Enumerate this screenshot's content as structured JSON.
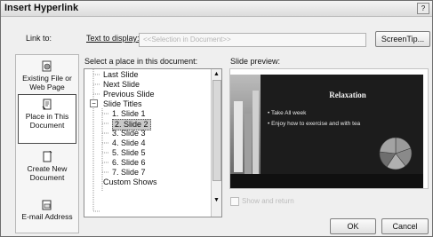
{
  "dialog": {
    "title": "Insert Hyperlink",
    "help_button": "?",
    "link_to_label": "Link to:",
    "text_display_label": "Text to display:",
    "text_display_value": "<<Selection in Document>>",
    "screentip_button": "ScreenTip...",
    "select_place_label": "Select a place in this document:",
    "slide_preview_label": "Slide preview:",
    "show_and_return_label": "Show and return",
    "ok_button": "OK",
    "cancel_button": "Cancel"
  },
  "link_to": [
    {
      "line1": "Existing File or",
      "line2": "Web Page",
      "icon": "globe-file-icon"
    },
    {
      "line1": "Place in This",
      "line2": "Document",
      "icon": "document-place-icon"
    },
    {
      "line1": "Create New",
      "line2": "Document",
      "icon": "new-document-icon"
    },
    {
      "line1": "E-mail Address",
      "line2": "",
      "icon": "email-icon"
    }
  ],
  "tree": {
    "items": [
      "Last Slide",
      "Next Slide",
      "Previous Slide",
      "Slide Titles",
      "1. Slide 1",
      "2. Slide 2",
      "3. Slide 3",
      "4. Slide 4",
      "5. Slide 5",
      "6. Slide 6",
      "7. Slide 7",
      "Custom Shows"
    ],
    "selected": "2. Slide 2"
  },
  "slide": {
    "title": "Relaxation",
    "bullet1": "Take All week",
    "bullet2": "Enjoy how to exercise and with tea"
  }
}
